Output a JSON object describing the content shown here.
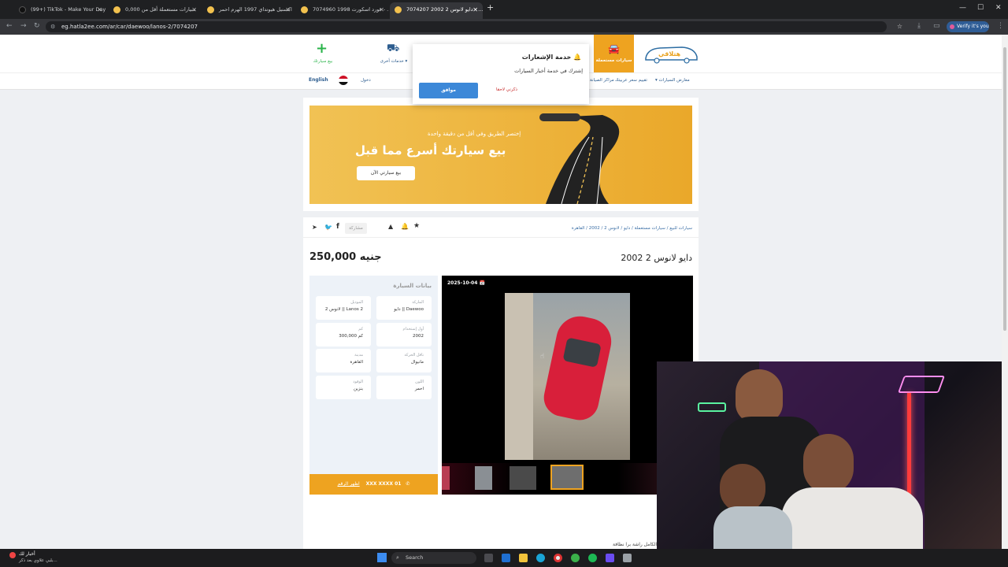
{
  "browser": {
    "tabs": [
      {
        "title": "(99+) TikTok - Make Your Day",
        "active": false
      },
      {
        "title": "سيارات مستعملة أقل من 0,000",
        "active": false
      },
      {
        "title": "اكسنيل هيونداي 1997 الهرم احمر",
        "active": false
      },
      {
        "title": "فورد اسكورت 1998 7074960 - ...",
        "active": false
      },
      {
        "title": "دايو لانوس 2 2002 7074207 - ...",
        "active": true
      }
    ],
    "url": "eg.hatla2ee.com/ar/car/daewoo/lanos-2/7074207",
    "verify_label": "Verify it's you"
  },
  "header": {
    "logo_text": "هتلاقي",
    "used_cars": "سيارات مستعملة",
    "other_services": "خدمات أخرى",
    "sell_car": "بيع سيارتك",
    "nav_items": [
      "معارض السيارات",
      "تقييم سعر عربيتك",
      "مراكز الصيانة"
    ],
    "login": "دخول",
    "language": "English"
  },
  "notification": {
    "title": "خدمة الإشعارات",
    "body": "إشترك في خدمة أخبار السيارات",
    "accept": "موافق",
    "later": "ذكرني لاحقا"
  },
  "banner": {
    "small": "إختصر الطريق وفي أقل من دقيقة واحدة",
    "big": "بيع سيارتك أسرع مما قبل",
    "cta": "بيع سيارتي الآن"
  },
  "breadcrumb": [
    "سيارات للبيع",
    "سيارات مستعملة",
    "دايو",
    "لانوس 2",
    "2002",
    "القاهرة"
  ],
  "share_label": "مشاركة",
  "listing": {
    "title": "دايو لانوس 2 2002",
    "price": "250,000 جنيه",
    "date": "2025-10-04"
  },
  "specs": {
    "heading": "بيانات السيارة",
    "items": [
      {
        "label": "الماركة",
        "value": "دايو || Daewoo"
      },
      {
        "label": "الموديل",
        "value": "لانوس 2 || Lanos 2"
      },
      {
        "label": "أول إستخدام",
        "value": "2002"
      },
      {
        "label": "كم",
        "value": "300,000 كم"
      },
      {
        "label": "ناقل الحركة",
        "value": "مانيوال"
      },
      {
        "label": "مدينة",
        "value": "القاهرة"
      },
      {
        "label": "اللون",
        "value": "احمر"
      },
      {
        "label": "الوقود",
        "value": "بنزين"
      }
    ],
    "phone": "XXX XXXX 01",
    "show_number": "اظهر الرقم"
  },
  "footer_text": "الكامل راشة برا نظافة",
  "taskbar": {
    "news_title": "أخبار لك",
    "news_sub": "بلبي علاوي بعد ذكر...",
    "search": "Search"
  }
}
